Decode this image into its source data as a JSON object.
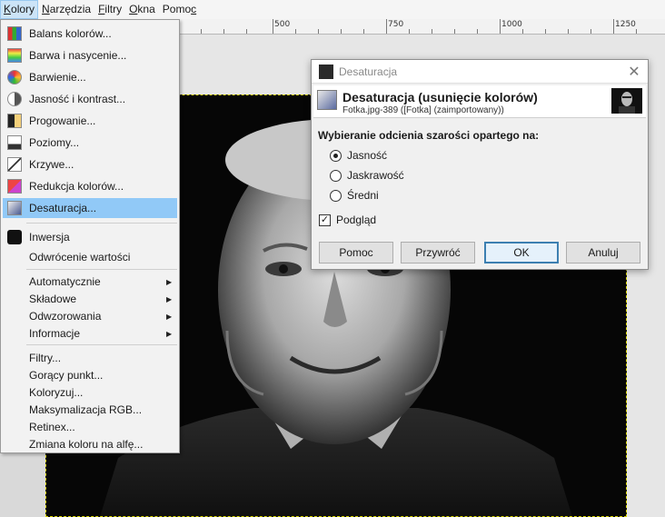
{
  "menubar": {
    "items": [
      {
        "label": "Kolory",
        "u": "K",
        "rest": "olory"
      },
      {
        "label": "Narzędzia",
        "u": "N",
        "rest": "arzędzia"
      },
      {
        "label": "Filtry",
        "u": "F",
        "rest": "iltry"
      },
      {
        "label": "Okna",
        "u": "O",
        "rest": "kna"
      },
      {
        "label": "Pomoc",
        "pre": "Pomo",
        "u": "c"
      }
    ]
  },
  "ruler": {
    "labels": [
      "500",
      "750",
      "1000",
      "1250"
    ]
  },
  "menu": {
    "items": [
      {
        "label": "Balans kolorów...",
        "icon": "color-balance-icon"
      },
      {
        "label": "Barwa i nasycenie...",
        "icon": "hue-saturation-icon"
      },
      {
        "label": "Barwienie...",
        "icon": "colorize-icon"
      },
      {
        "label": "Jasność i kontrast...",
        "icon": "brightness-contrast-icon"
      },
      {
        "label": "Progowanie...",
        "icon": "threshold-icon"
      },
      {
        "label": "Poziomy...",
        "icon": "levels-icon"
      },
      {
        "label": "Krzywe...",
        "icon": "curves-icon"
      },
      {
        "label": "Redukcja kolorów...",
        "icon": "posterize-icon"
      },
      {
        "label": "Desaturacja...",
        "icon": "desaturate-icon",
        "selected": true
      },
      {
        "label": "Inwersja",
        "icon": "invert-icon"
      },
      {
        "label": "Odwrócenie wartości"
      },
      {
        "label": "Automatycznie",
        "submenu": true
      },
      {
        "label": "Składowe",
        "submenu": true
      },
      {
        "label": "Odwzorowania",
        "submenu": true
      },
      {
        "label": "Informacje",
        "submenu": true
      },
      {
        "label": "Filtry..."
      },
      {
        "label": "Gorący punkt..."
      },
      {
        "label": "Koloryzuj..."
      },
      {
        "label": "Maksymalizacja RGB..."
      },
      {
        "label": "Retinex..."
      },
      {
        "label": "Zmiana koloru na alfę..."
      }
    ]
  },
  "dialog": {
    "window_title": "Desaturacja",
    "heading": "Desaturacja (usunięcie kolorów)",
    "subheading": "Fotka.jpg-389 ([Fotka] (zaimportowany))",
    "group_title": "Wybieranie odcienia szarości opartego na:",
    "options": [
      {
        "label": "Jasność",
        "checked": true
      },
      {
        "label": "Jaskrawość",
        "checked": false
      },
      {
        "label": "Średni",
        "checked": false
      }
    ],
    "preview_label": "Podgląd",
    "preview_checked": true,
    "buttons": {
      "help": "Pomoc",
      "reset": "Przywróć",
      "ok": "OK",
      "cancel": "Anuluj"
    }
  }
}
